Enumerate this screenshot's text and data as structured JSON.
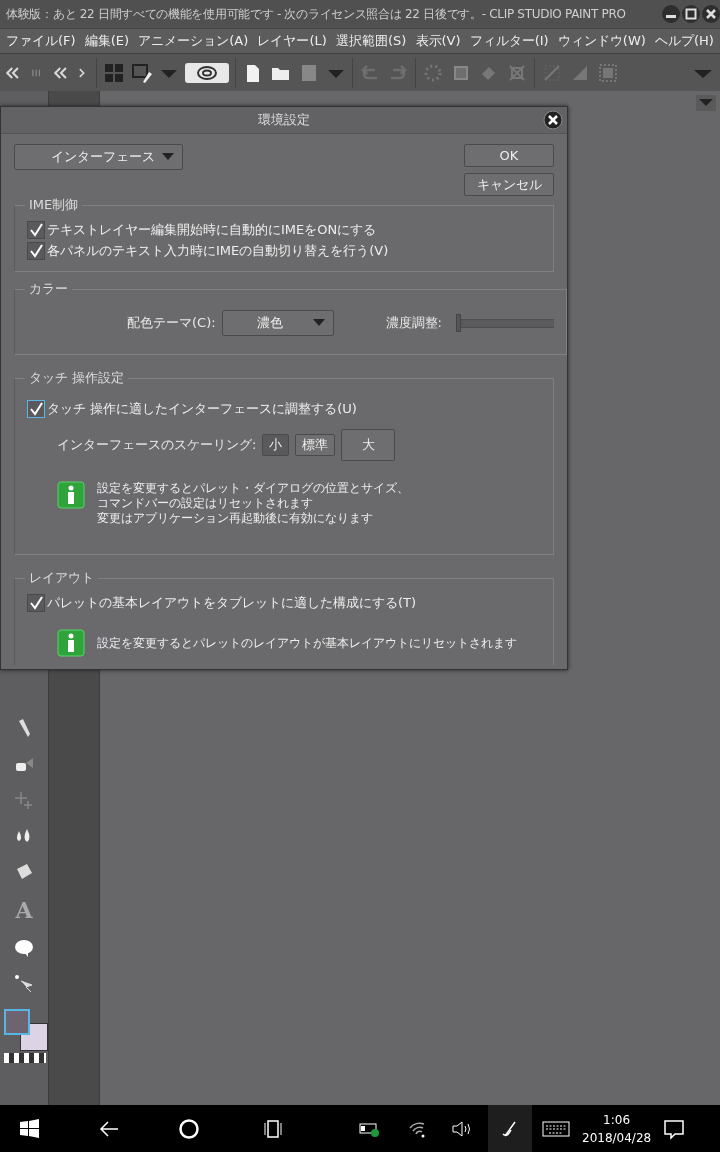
{
  "title_bar": {
    "title": "体験版：あと 22 日間すべての機能を使用可能です - 次のライセンス照合は 22 日後です。- CLIP STUDIO PAINT PRO"
  },
  "menu": [
    "ファイル(F)",
    "編集(E)",
    "アニメーション(A)",
    "レイヤー(L)",
    "選択範囲(S)",
    "表示(V)",
    "フィルター(I)",
    "ウィンドウ(W)",
    "ヘルプ(H)"
  ],
  "dialog": {
    "title": "環境設定",
    "category": "インターフェース",
    "buttons": [
      "OK",
      "キャンセル"
    ],
    "ime": {
      "label": "IME制御",
      "options": [
        {
          "label": "テキストレイヤー編集開始時に自動的にIMEをONにする",
          "checked": true
        },
        {
          "label": "各パネルのテキスト入力時にIMEの自動切り替えを行う(V)",
          "checked": true
        }
      ]
    },
    "color": {
      "label": "カラー",
      "theme_label": "配色テーマ(C):",
      "theme_value": "濃色",
      "density_label": "濃度調整:",
      "density": {
        "level": 0
      }
    },
    "touch": {
      "label": "タッチ 操作設定",
      "option": {
        "label": "タッチ 操作に適したインターフェースに調整する(U)",
        "checked": true
      },
      "scaling_label": "インターフェースのスケーリング:",
      "scales": [
        {
          "label": "小",
          "selected": true
        },
        {
          "label": "標準",
          "selected": false
        },
        {
          "label": "大",
          "selected": false
        }
      ],
      "note": [
        "設定を変更するとパレット・ダイアログの位置とサイズ、",
        "コマンドバーの設定はリセットされます",
        "変更はアプリケーション再起動後に有効になります"
      ]
    },
    "layout": {
      "label": "レイアウト",
      "option": {
        "label": "パレットの基本レイアウトをタブレットに適した構成にする(T)",
        "checked": true
      },
      "note": "設定を変更するとパレットのレイアウトが基本レイアウトにリセットされます"
    }
  },
  "tool_glyph": "A",
  "taskbar": {
    "time": "1:06",
    "date": "2018/04/28"
  }
}
